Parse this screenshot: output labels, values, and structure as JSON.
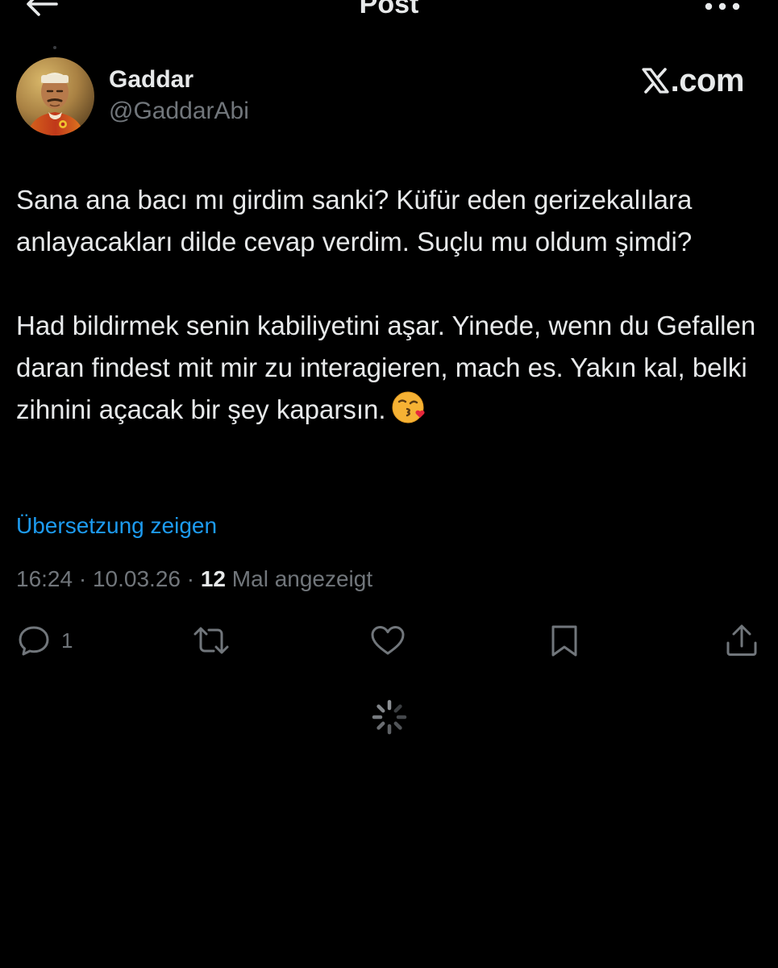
{
  "header": {
    "title": "Post",
    "back_icon": "arrow-left-icon",
    "more_icon": "more-horizontal-icon"
  },
  "author": {
    "display_name": "Gaddar",
    "handle": "@GaddarAbi",
    "avatar_icon": "avatar-portrait"
  },
  "watermark": {
    "label": ".com",
    "icon": "x-logo-icon"
  },
  "tweet": {
    "paragraph_1": "Sana ana bacı mı girdim sanki? Küfür eden gerizekalılara anlayacakları dilde cevap verdim. Suçlu mu oldum şimdi?",
    "paragraph_2": "Had bildirmek senin kabiliyetini aşar. Yinede, wenn du Gefallen daran findest mit mir zu interagieren, mach es. Yakın kal, belki zihnini açacak bir şey kaparsın.",
    "emoji": "kissing-face-with-heart-emoji"
  },
  "translate": {
    "label": "Übersetzung zeigen"
  },
  "meta": {
    "time": "16:24",
    "separator": "·",
    "date": "10.03.26",
    "views_count": "12",
    "views_label": "Mal angezeigt"
  },
  "actions": {
    "reply_count": "1",
    "reply_icon": "reply-icon",
    "repost_icon": "repost-icon",
    "like_icon": "heart-icon",
    "bookmark_icon": "bookmark-icon",
    "share_icon": "share-icon"
  },
  "loading": {
    "icon": "loading-spinner-icon"
  },
  "colors": {
    "background": "#000000",
    "text_primary": "#e7e9ea",
    "text_secondary": "#71767b",
    "link": "#1d9bf0"
  }
}
